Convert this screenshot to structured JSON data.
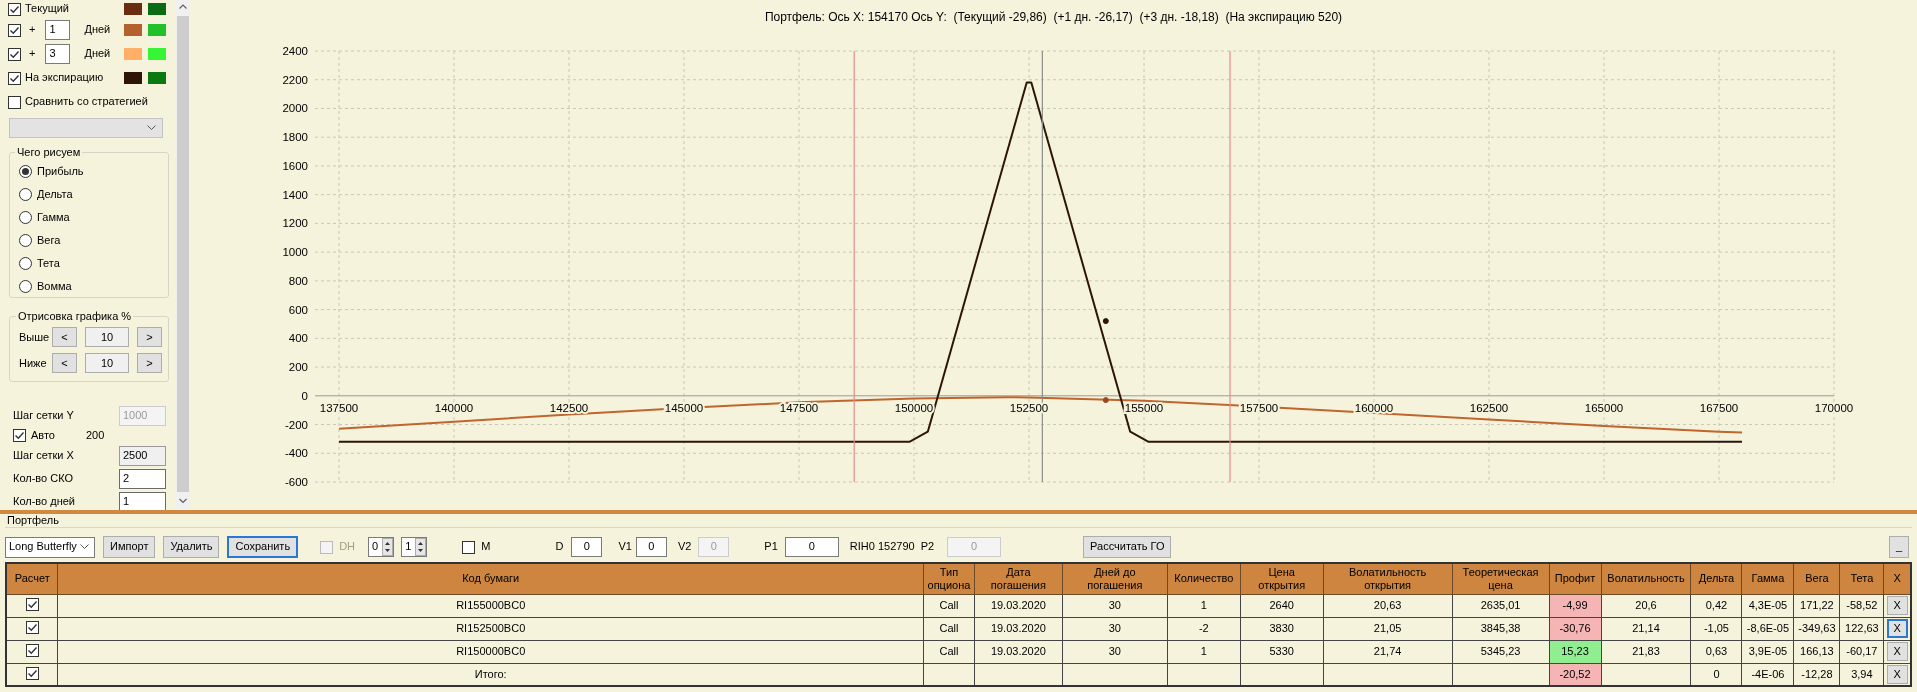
{
  "left_panel": {
    "curves": [
      {
        "kind": "plain",
        "label": "Текущий",
        "checked": true,
        "swatches": [
          {
            "color": "#6b2d12"
          },
          {
            "color": "#0b6b12"
          }
        ]
      },
      {
        "kind": "days",
        "prefix": "+",
        "days": "1",
        "label": "Дней",
        "checked": true,
        "swatches": [
          {
            "color": "#b5612d"
          },
          {
            "color": "#22c02a"
          }
        ]
      },
      {
        "kind": "days",
        "prefix": "+",
        "days": "3",
        "label": "Дней",
        "checked": true,
        "swatches": [
          {
            "color": "#ffb066"
          },
          {
            "color": "#35f535"
          }
        ]
      },
      {
        "kind": "plain",
        "label": "На экспирацию",
        "checked": true,
        "swatches": [
          {
            "color": "#2d1608"
          },
          {
            "color": "#0a7a10"
          }
        ]
      }
    ],
    "compare": {
      "label": "Сравнить со стратегией",
      "checked": false
    },
    "strategy_select": {
      "disabled": true
    },
    "draw_group": {
      "title": "Чего рисуем",
      "options": [
        {
          "label": "Прибыль",
          "selected": true
        },
        {
          "label": "Дельта",
          "selected": false
        },
        {
          "label": "Гамма",
          "selected": false
        },
        {
          "label": "Вега",
          "selected": false
        },
        {
          "label": "Тета",
          "selected": false
        },
        {
          "label": "Вомма",
          "selected": false
        }
      ]
    },
    "range_group": {
      "title": "Отрисовка графика %",
      "rows": [
        {
          "label": "Выше",
          "dec": "<",
          "value": "10",
          "inc": ">"
        },
        {
          "label": "Ниже",
          "dec": "<",
          "value": "10",
          "inc": ">"
        }
      ]
    },
    "settings": [
      {
        "kind": "field",
        "label": "Шаг сетки Y",
        "value": "1000",
        "disabled": true,
        "readonly": true
      },
      {
        "kind": "check",
        "label": "Авто",
        "checked": true,
        "value": "200"
      },
      {
        "kind": "field",
        "label": "Шаг сетки X",
        "value": "2500",
        "disabled": false,
        "readonly": true
      },
      {
        "kind": "field",
        "label": "Кол-во СКО",
        "value": "2",
        "disabled": false,
        "readonly": false
      },
      {
        "kind": "field",
        "label": "Кол-во дней",
        "value": "1",
        "disabled": false,
        "readonly": false
      }
    ]
  },
  "chart": {
    "title": "Портфель: Ось X: 154170 Ось Y:  (Текущий -29,86)  (+1 дн. -26,17)  (+3 дн. -18,18)  (На экспирацию 520)",
    "chart_data": {
      "type": "line",
      "grid": true,
      "xlim": [
        137500,
        170000
      ],
      "ylim": [
        -600,
        2400
      ],
      "xticks": [
        137500,
        140000,
        142500,
        145000,
        147500,
        150000,
        152500,
        155000,
        157500,
        160000,
        162500,
        165000,
        167500,
        170000
      ],
      "yticks": [
        2400,
        2200,
        2000,
        1800,
        1600,
        1400,
        1200,
        1000,
        800,
        600,
        400,
        200,
        0,
        -200,
        -400,
        -600
      ],
      "series": [
        {
          "color": "#c0652d",
          "x": [
            137500,
            140000,
            142500,
            145000,
            147500,
            150000,
            152000,
            152500,
            155000,
            157500,
            160000,
            162500,
            165000,
            167500,
            168000
          ],
          "values": [
            -230,
            -180,
            -130,
            -85,
            -45,
            -18,
            -10,
            -12,
            -35,
            -75,
            -120,
            -165,
            -210,
            -250,
            -256
          ]
        },
        {
          "color": "#2d1608",
          "x": [
            137500,
            149900,
            150300,
            152450,
            152550,
            154700,
            155100,
            168000
          ],
          "values": [
            -320,
            -320,
            -250,
            2180,
            2180,
            -250,
            -320,
            -320
          ]
        },
        {
          "color": "#2d1608",
          "x": [
            154170
          ],
          "values": [
            520
          ],
          "marker": "o"
        },
        {
          "color": "#9a4a20",
          "x": [
            154170
          ],
          "values": [
            -30
          ],
          "marker": "o"
        },
        {
          "color": "#e88a8a",
          "x": [
            148700,
            148700
          ],
          "values": [
            -600,
            2400
          ]
        },
        {
          "color": "#e88a8a",
          "x": [
            156870,
            156870
          ],
          "values": [
            -600,
            2400
          ]
        },
        {
          "color": "#8c8c8c",
          "x": [
            152790,
            152790
          ],
          "values": [
            -600,
            2400
          ]
        }
      ]
    }
  },
  "portfolio": {
    "title": "Портфель",
    "toolbar": [
      {
        "kind": "select",
        "value": "Long Butterfly"
      },
      {
        "kind": "button",
        "label": "Импорт",
        "focused": false
      },
      {
        "kind": "button",
        "label": "Удалить",
        "focused": false
      },
      {
        "kind": "button",
        "label": "Сохранить",
        "focused": true
      },
      {
        "kind": "check",
        "label": "DH",
        "checked": false,
        "disabled": true
      },
      {
        "kind": "spin",
        "value": "0"
      },
      {
        "kind": "spin",
        "value": "1"
      },
      {
        "kind": "check",
        "label": "M",
        "checked": false,
        "disabled": false
      },
      {
        "kind": "text",
        "label": "D"
      },
      {
        "kind": "field",
        "value": "0",
        "disabled": false
      },
      {
        "kind": "text",
        "label": "V1"
      },
      {
        "kind": "field",
        "value": "0",
        "disabled": false
      },
      {
        "kind": "text",
        "label": "V2"
      },
      {
        "kind": "field",
        "value": "0",
        "disabled": true
      },
      {
        "kind": "text",
        "label": "P1"
      },
      {
        "kind": "field",
        "value": "0",
        "disabled": false
      },
      {
        "kind": "text",
        "label": "RIH0 152790"
      },
      {
        "kind": "text",
        "label": "P2"
      },
      {
        "kind": "field",
        "value": "0",
        "disabled": true
      },
      {
        "kind": "button",
        "label": "Рассчитать ГО",
        "focused": false
      },
      {
        "kind": "button",
        "label": "_",
        "focused": false
      }
    ],
    "columns": [
      {
        "label": "Расчет",
        "kind": "check"
      },
      {
        "label": "Код бумаги",
        "kind": "text"
      },
      {
        "label": "Тип\nопциона",
        "kind": "text"
      },
      {
        "label": "Дата\nпогашения",
        "kind": "text"
      },
      {
        "label": "Дней до\nпогашения",
        "kind": "text"
      },
      {
        "label": "Количество",
        "kind": "text"
      },
      {
        "label": "Цена\nоткрытия",
        "kind": "text"
      },
      {
        "label": "Волатильность\nоткрытия",
        "kind": "text"
      },
      {
        "label": "Теоретическая\nцена",
        "kind": "text"
      },
      {
        "label": "Профит",
        "kind": "profit"
      },
      {
        "label": "Волатильность",
        "kind": "text"
      },
      {
        "label": "Дельта",
        "kind": "text"
      },
      {
        "label": "Гамма",
        "kind": "text"
      },
      {
        "label": "Вега",
        "kind": "text"
      },
      {
        "label": "Тета",
        "kind": "text"
      },
      {
        "label": "X",
        "kind": "action"
      }
    ],
    "rows": [
      {
        "cells": [
          {
            "checked": true
          },
          "RI155000BC0",
          "Call",
          "19.03.2020",
          "30",
          "1",
          "2640",
          "20,63",
          "2635,01",
          {
            "text": "-4,99",
            "color": "#f5b5b5"
          },
          "20,6",
          "0,42",
          "4,3E-05",
          "171,22",
          "-58,52",
          {
            "text": "X",
            "focused": false
          }
        ]
      },
      {
        "cells": [
          {
            "checked": true
          },
          "RI152500BC0",
          "Call",
          "19.03.2020",
          "30",
          "-2",
          "3830",
          "21,05",
          "3845,38",
          {
            "text": "-30,76",
            "color": "#f5b5b5"
          },
          "21,14",
          "-1,05",
          "-8,6E-05",
          "-349,63",
          "122,63",
          {
            "text": "X",
            "focused": true
          }
        ]
      },
      {
        "cells": [
          {
            "checked": true
          },
          "RI150000BC0",
          "Call",
          "19.03.2020",
          "30",
          "1",
          "5330",
          "21,74",
          "5345,23",
          {
            "text": "15,23",
            "color": "#90ee90"
          },
          "21,83",
          "0,63",
          "3,9E-05",
          "166,13",
          "-60,17",
          {
            "text": "X",
            "focused": false
          }
        ]
      },
      {
        "cells": [
          {
            "checked": true
          },
          "Итого:",
          "",
          "",
          "",
          "",
          "",
          "",
          "",
          {
            "text": "-20,52",
            "color": "#f5b5b5"
          },
          "",
          "0",
          "-4E-06",
          "-12,28",
          "3,94",
          {
            "text": "X",
            "focused": false
          }
        ]
      }
    ]
  }
}
